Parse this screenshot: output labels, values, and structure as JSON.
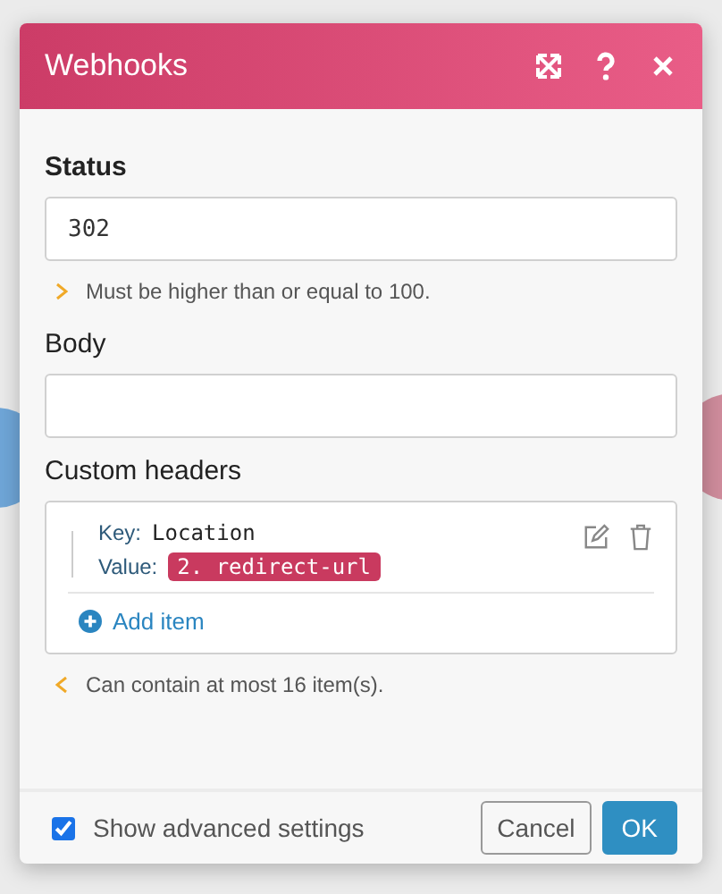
{
  "dialog": {
    "title": "Webhooks"
  },
  "fields": [
    {
      "label": "Status",
      "bold": true,
      "value": "302",
      "hint": "Must be higher than or equal to 100."
    },
    {
      "label": "Body",
      "bold": false
    }
  ],
  "custom_headers": {
    "label": "Custom headers",
    "items": [
      {
        "key_label": "Key:",
        "key": "Location",
        "value_label": "Value:",
        "value": "2. redirect-url"
      }
    ],
    "add_label": "Add item",
    "hint": "Can contain at most 16 item(s)."
  },
  "footer": {
    "advanced": {
      "label": "Show advanced settings",
      "checked": true
    },
    "buttons": [
      {
        "label": "Cancel",
        "kind": "secondary"
      },
      {
        "label": "OK",
        "kind": "primary"
      }
    ]
  }
}
